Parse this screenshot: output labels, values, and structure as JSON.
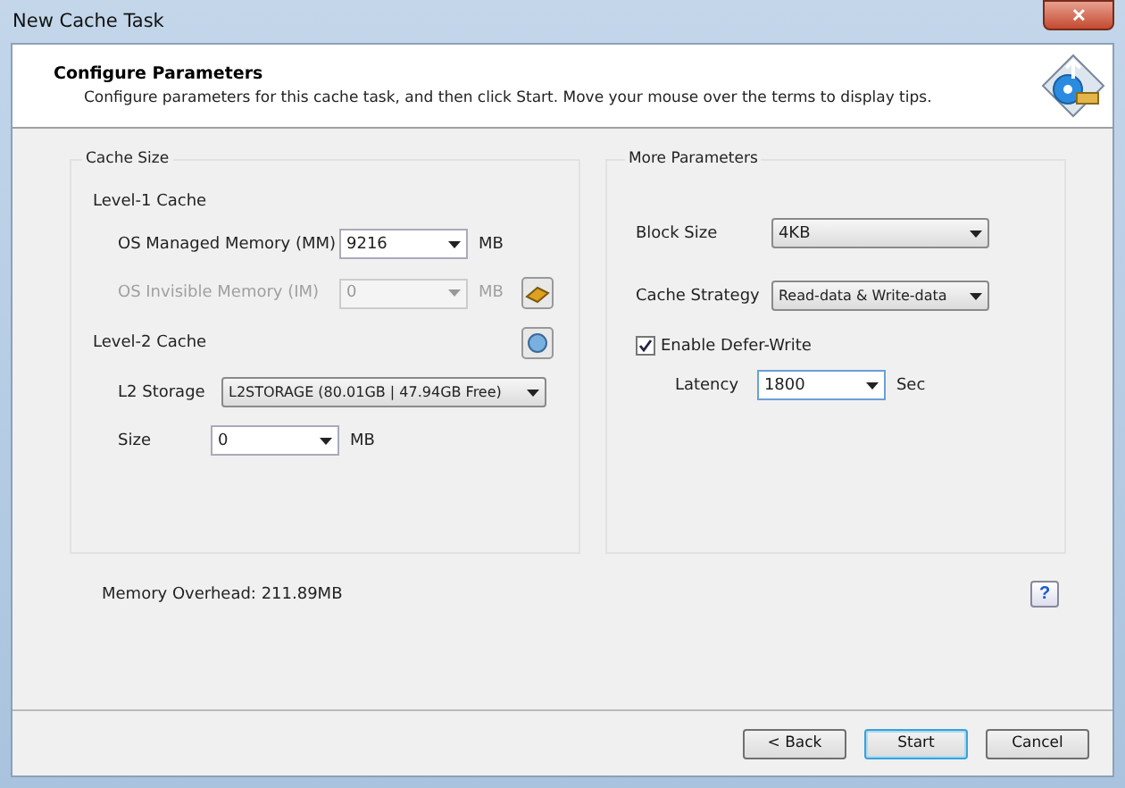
{
  "window": {
    "title": "New Cache Task",
    "close": "✕"
  },
  "header": {
    "title": "Configure Parameters",
    "description": "Configure parameters for this cache task, and then click Start. Move your mouse over the terms to display tips."
  },
  "cache_size": {
    "title": "Cache Size",
    "level1": {
      "title": "Level-1 Cache",
      "rows": [
        {
          "label": "OS Managed Memory (MM)",
          "value": "9216",
          "unit": "MB",
          "disabled": false
        },
        {
          "label": "OS Invisible Memory (IM)",
          "value": "0",
          "unit": "MB",
          "disabled": true
        }
      ]
    },
    "level2": {
      "title": "Level-2 Cache",
      "storage": {
        "label": "L2 Storage",
        "value": "L2STORAGE (80.01GB | 47.94GB Free)"
      },
      "size": {
        "label": "Size",
        "value": "0",
        "unit": "MB"
      }
    }
  },
  "more_parameters": {
    "title": "More Parameters",
    "block_size": {
      "label": "Block Size",
      "value": "4KB"
    },
    "cache_strategy": {
      "label": "Cache Strategy",
      "value": "Read-data & Write-data"
    },
    "defer_write": {
      "label": "Enable Defer-Write",
      "checked": true
    },
    "latency": {
      "label": "Latency",
      "value": "1800",
      "unit": "Sec"
    }
  },
  "memory_overhead": "Memory Overhead: 211.89MB",
  "help": "?",
  "buttons": [
    {
      "label": "< Back",
      "default": false
    },
    {
      "label": "Start",
      "default": true
    },
    {
      "label": "Cancel",
      "default": false
    }
  ]
}
